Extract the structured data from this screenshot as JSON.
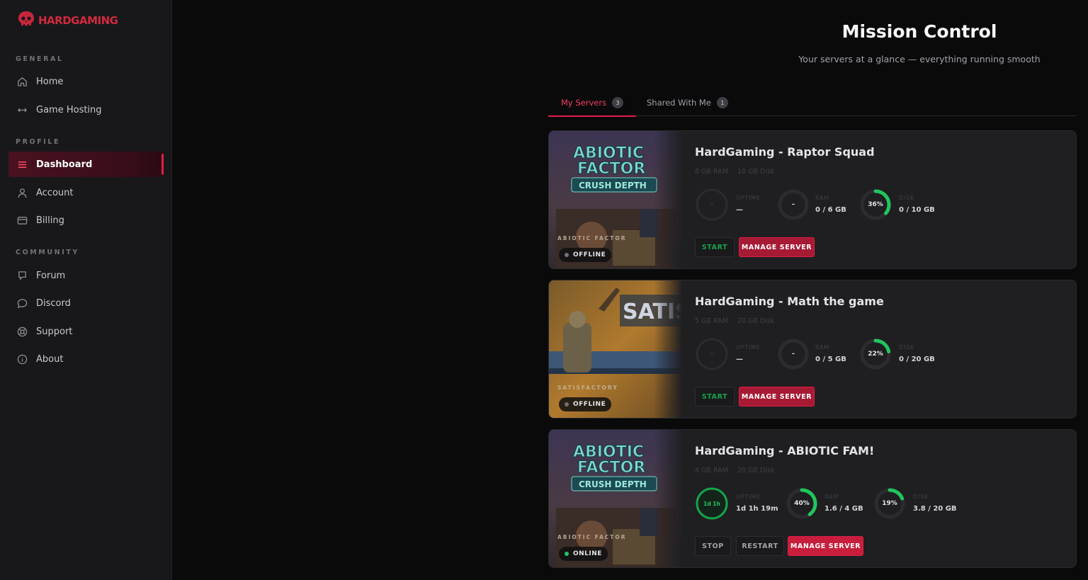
{
  "brand": {
    "name": "HARDGAMING",
    "color": "#d12a3d"
  },
  "sidebar": {
    "sections": [
      {
        "title": "GENERAL",
        "items": [
          {
            "label": "Home",
            "icon": "home-icon"
          },
          {
            "label": "Game Hosting",
            "icon": "arrows-icon"
          }
        ]
      },
      {
        "title": "PROFILE",
        "items": [
          {
            "label": "Dashboard",
            "icon": "dashboard-icon",
            "active": true
          },
          {
            "label": "Account",
            "icon": "user-icon"
          },
          {
            "label": "Billing",
            "icon": "card-icon"
          }
        ]
      },
      {
        "title": "COMMUNITY",
        "items": [
          {
            "label": "Forum",
            "icon": "forum-icon"
          },
          {
            "label": "Discord",
            "icon": "chat-icon"
          },
          {
            "label": "Support",
            "icon": "lifebuoy-icon"
          },
          {
            "label": "About",
            "icon": "info-icon"
          }
        ]
      }
    ]
  },
  "header": {
    "title": "Mission Control",
    "subtitle": "Your servers at a glance — everything running smooth"
  },
  "tabs": [
    {
      "label": "My Servers",
      "count": "3",
      "active": true
    },
    {
      "label": "Shared With Me",
      "count": "1",
      "active": false
    }
  ],
  "labels": {
    "uptime": "UPTIME",
    "ram": "RAM",
    "disk": "DISK"
  },
  "servers": [
    {
      "name": "HardGaming - Raptor Squad",
      "ram_spec": "6 GB RAM",
      "disk_spec": "10 GB Disk",
      "game": "ABIOTIC FACTOR",
      "art_title_1": "ABIOTIC",
      "art_title_2": "FACTOR",
      "art_title_3": "CRUSH DEPTH",
      "status": "OFFLINE",
      "uptime_gauge": "–",
      "uptime_value": "—",
      "uptime_pct": 0,
      "ram_gauge": "–",
      "ram_value": "0 / 6 GB",
      "ram_pct": 0,
      "disk_gauge": "36%",
      "disk_value": "0 / 10 GB",
      "disk_pct": 36,
      "buttons": [
        "START",
        "MANAGE SERVER"
      ]
    },
    {
      "name": "HardGaming - Math the game",
      "ram_spec": "5 GB RAM",
      "disk_spec": "20 GB Disk",
      "game": "SATISFACTORY",
      "art_title_1": "SATIS",
      "status": "OFFLINE",
      "uptime_gauge": "–",
      "uptime_value": "—",
      "uptime_pct": 0,
      "ram_gauge": "–",
      "ram_value": "0 / 5 GB",
      "ram_pct": 0,
      "disk_gauge": "22%",
      "disk_value": "0 / 20 GB",
      "disk_pct": 22,
      "buttons": [
        "START",
        "MANAGE SERVER"
      ]
    },
    {
      "name": "HardGaming - ABIOTIC FAM!",
      "ram_spec": "4 GB RAM",
      "disk_spec": "20 GB Disk",
      "game": "ABIOTIC FACTOR",
      "art_title_1": "ABIOTIC",
      "art_title_2": "FACTOR",
      "art_title_3": "CRUSH DEPTH",
      "status": "ONLINE",
      "uptime_gauge": "1d 1h",
      "uptime_value": "1d 1h 19m",
      "uptime_pct": 100,
      "ram_gauge": "40%",
      "ram_value": "1.6 / 4 GB",
      "ram_pct": 40,
      "disk_gauge": "19%",
      "disk_value": "3.8 / 20 GB",
      "disk_pct": 19,
      "buttons": [
        "STOP",
        "RESTART",
        "MANAGE SERVER"
      ]
    }
  ],
  "colors": {
    "accent": "#e11d48",
    "online": "#22c55e",
    "gauge": "#22c55e"
  }
}
